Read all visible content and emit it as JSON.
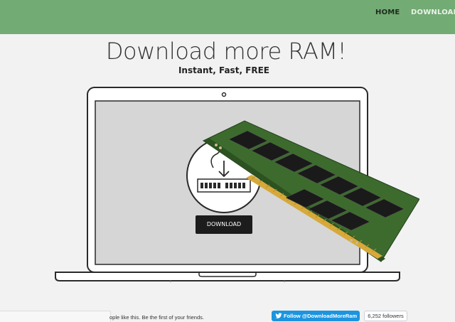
{
  "nav": {
    "home": "HOME",
    "download": "DOWNLOAD"
  },
  "hero": {
    "title": "Download more RAM!",
    "subtitle": "Instant, Fast, FREE"
  },
  "screen": {
    "download_button": "DOWNLOAD"
  },
  "social": {
    "facebook_text": "ople like this. Be the first of your friends.",
    "twitter_follow": "Follow @DownloadMoreRam",
    "followers": "6,252 followers"
  },
  "colors": {
    "navbar": "#72ab73",
    "button": "#1c1c1c",
    "twitter": "#1b95e0",
    "ram_pcb": "#3d6b2e",
    "ram_chip": "#1a1a1a",
    "ram_pins": "#d6a93a"
  },
  "icons": {
    "download": "cloud-download-icon",
    "memory": "ram-stick-icon",
    "twitter": "twitter-bird-icon"
  }
}
